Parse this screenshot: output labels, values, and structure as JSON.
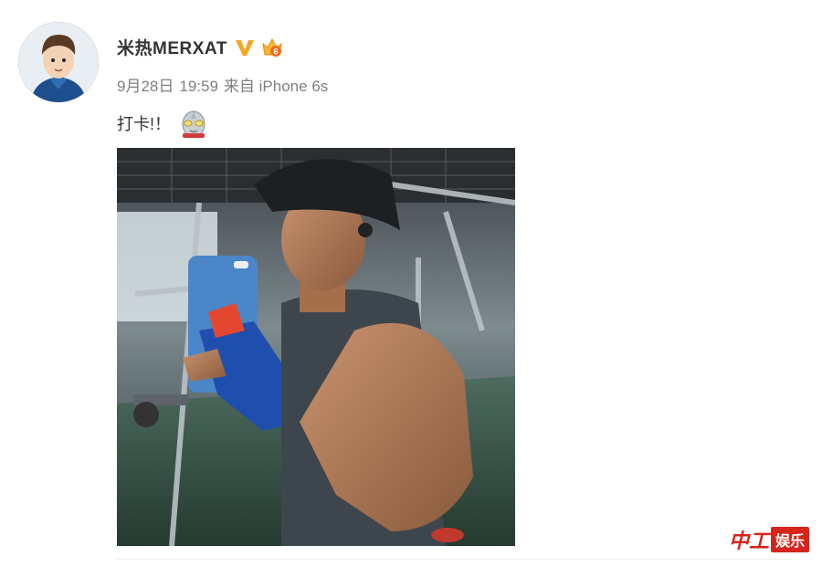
{
  "post": {
    "username": "米热MERXAT",
    "date": "9月28日",
    "time": "19:59",
    "source_label": "来自",
    "device": "iPhone 6s",
    "text": "打卡!！"
  },
  "icons": {
    "avatar": "cartoon-avatar",
    "verified": "verified-v-icon",
    "level": "level-crown-icon",
    "emoji": "ultraman-emoji-icon"
  },
  "watermark": {
    "mark": "中工",
    "label": "娱乐"
  },
  "colors": {
    "username": "#333333",
    "meta": "#808080",
    "verified": "#f5a623",
    "watermark": "#d6251b"
  }
}
